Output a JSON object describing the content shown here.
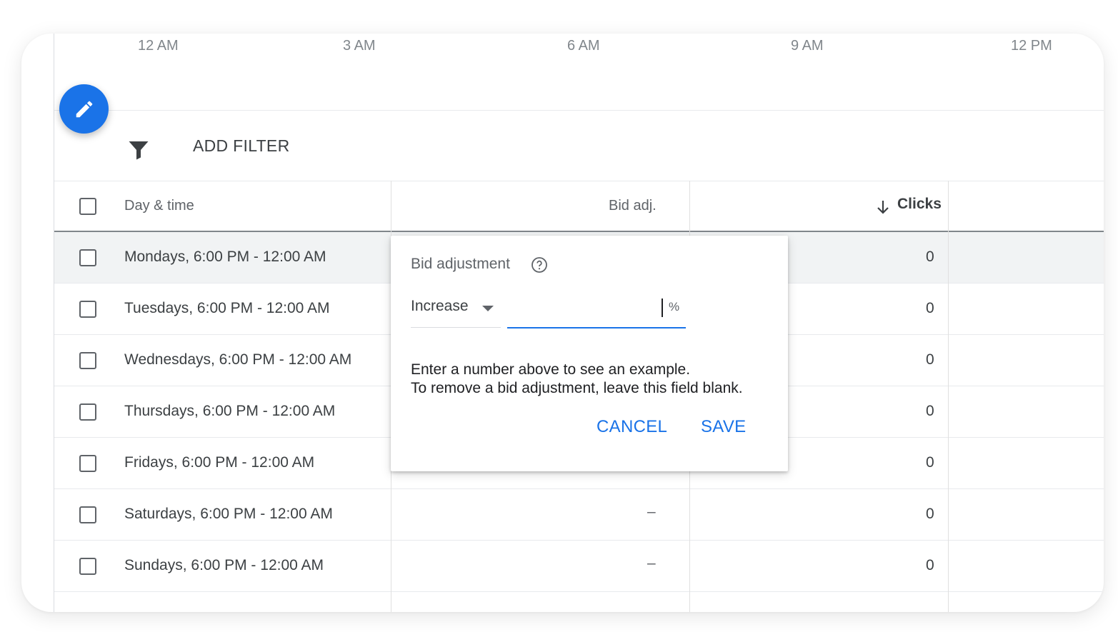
{
  "timeline": {
    "ticks": [
      "12 AM",
      "3 AM",
      "6 AM",
      "9 AM",
      "12 PM"
    ]
  },
  "toolbar": {
    "add_filter_label": "ADD FILTER",
    "filter_icon": "filter-icon",
    "edit_icon": "pencil-icon"
  },
  "table": {
    "columns": {
      "day_time": "Day & time",
      "bid_adj": "Bid adj.",
      "clicks": "Clicks",
      "sort_icon": "arrow-down-icon"
    },
    "rows": [
      {
        "day_time": "Mondays, 6:00 PM - 12:00 AM",
        "bid_adj": "",
        "clicks": "0"
      },
      {
        "day_time": "Tuesdays, 6:00 PM - 12:00 AM",
        "bid_adj": "",
        "clicks": "0"
      },
      {
        "day_time": "Wednesdays, 6:00 PM - 12:00 AM",
        "bid_adj": "",
        "clicks": "0"
      },
      {
        "day_time": "Thursdays, 6:00 PM - 12:00 AM",
        "bid_adj": "",
        "clicks": "0"
      },
      {
        "day_time": "Fridays, 6:00 PM - 12:00 AM",
        "bid_adj": "",
        "clicks": "0"
      },
      {
        "day_time": "Saturdays, 6:00 PM - 12:00 AM",
        "bid_adj": "–",
        "clicks": "0"
      },
      {
        "day_time": "Sundays, 6:00 PM - 12:00 AM",
        "bid_adj": "–",
        "clicks": "0"
      }
    ]
  },
  "popup": {
    "title": "Bid adjustment",
    "help_icon": "help-circle-icon",
    "select_value": "Increase",
    "input_value": "",
    "unit": "%",
    "hint_line1": "Enter a number above to see an example.",
    "hint_line2": "To remove a bid adjustment, leave this field blank.",
    "cancel_label": "CANCEL",
    "save_label": "SAVE"
  },
  "colors": {
    "accent": "#1a73e8",
    "text": "#3c4043",
    "muted": "#5f6368",
    "highlight_row": "#f1f3f4"
  }
}
